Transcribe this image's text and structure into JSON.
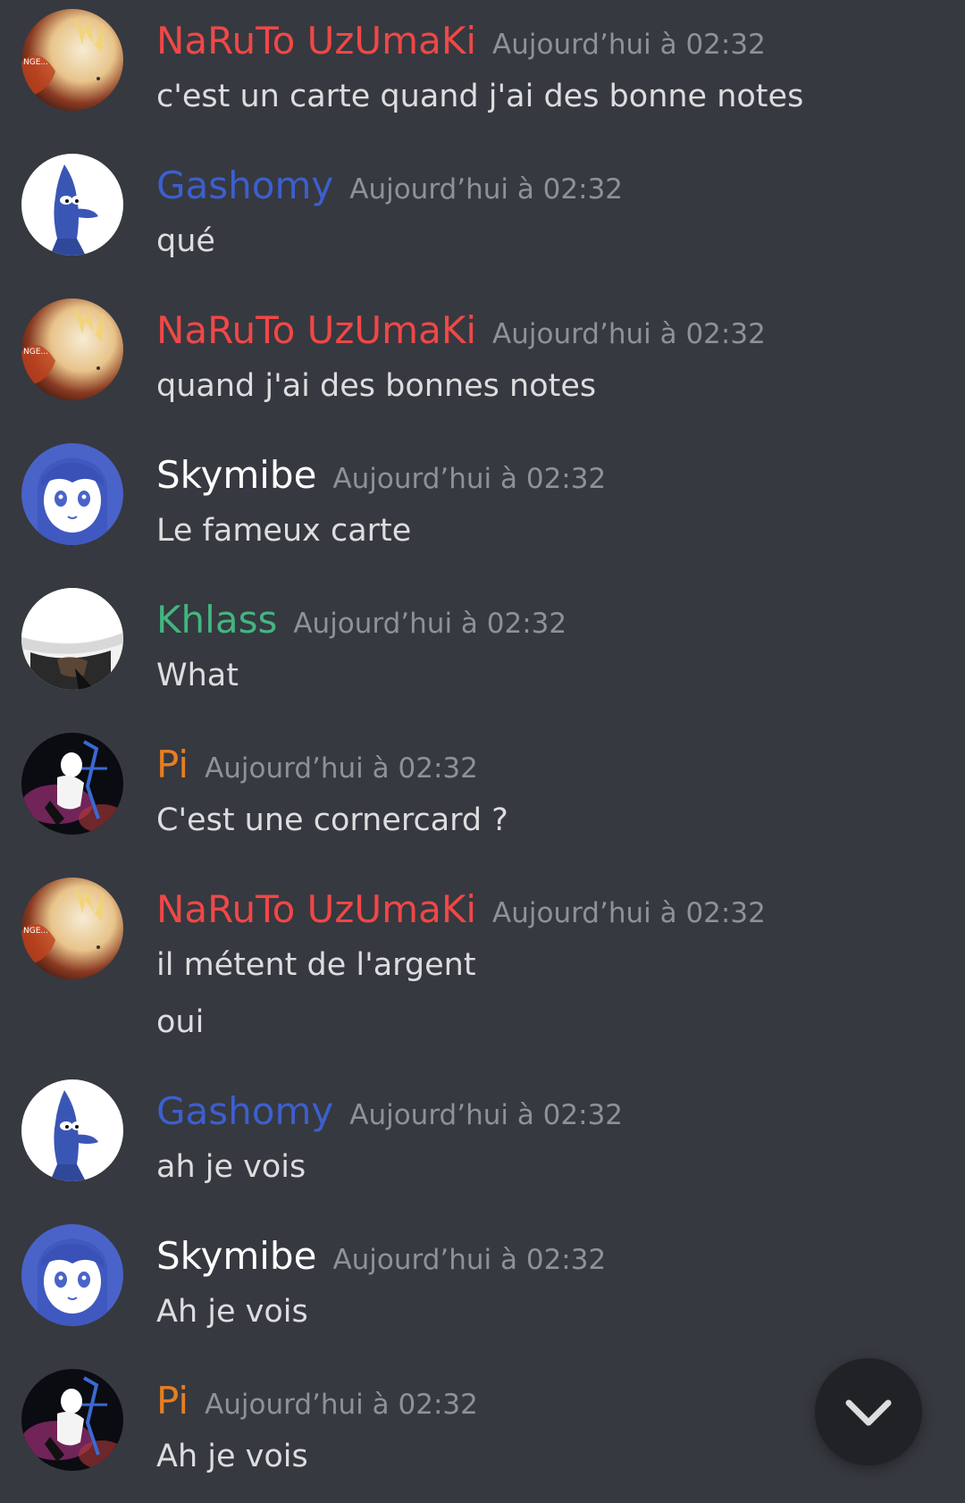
{
  "colors": {
    "background": "#36393f",
    "timestamp": "#8e9297",
    "message_text": "#dcddde",
    "naruto": "#f04747",
    "gashomy": "#3c5fcf",
    "skymibe": "#ffffff",
    "khlass": "#43b581",
    "pi": "#e67e22",
    "scroll_button": "#202225"
  },
  "messages": [
    {
      "avatar_icon": "naruto-avatar-icon",
      "username": "NaRuTo UzUmaKi",
      "timestamp": "Aujourd’hui à 02:32",
      "lines": [
        "c'est un carte quand j'ai des bonne notes"
      ]
    },
    {
      "avatar_icon": "duck-avatar-icon",
      "username": "Gashomy",
      "timestamp": "Aujourd’hui à 02:32",
      "lines": [
        "qué"
      ]
    },
    {
      "avatar_icon": "naruto-avatar-icon",
      "username": "NaRuTo UzUmaKi",
      "timestamp": "Aujourd’hui à 02:32",
      "lines": [
        "quand j'ai des bonnes notes"
      ]
    },
    {
      "avatar_icon": "anime-girl-avatar-icon",
      "username": "Skymibe",
      "timestamp": "Aujourd’hui à 02:32",
      "lines": [
        "Le fameux carte"
      ]
    },
    {
      "avatar_icon": "hat-avatar-icon",
      "username": "Khlass",
      "timestamp": "Aujourd’hui à 02:32",
      "lines": [
        "What"
      ]
    },
    {
      "avatar_icon": "chair-figure-avatar-icon",
      "username": "Pi",
      "timestamp": "Aujourd’hui à 02:32",
      "lines": [
        "C'est une cornercard ?"
      ]
    },
    {
      "avatar_icon": "naruto-avatar-icon",
      "username": "NaRuTo UzUmaKi",
      "timestamp": "Aujourd’hui à 02:32",
      "lines": [
        "il métent de l'argent",
        "oui"
      ]
    },
    {
      "avatar_icon": "duck-avatar-icon",
      "username": "Gashomy",
      "timestamp": "Aujourd’hui à 02:32",
      "lines": [
        "ah je vois"
      ]
    },
    {
      "avatar_icon": "anime-girl-avatar-icon",
      "username": "Skymibe",
      "timestamp": "Aujourd’hui à 02:32",
      "lines": [
        "Ah je vois"
      ]
    },
    {
      "avatar_icon": "chair-figure-avatar-icon",
      "username": "Pi",
      "timestamp": "Aujourd’hui à 02:32",
      "lines": [
        "Ah je vois"
      ]
    }
  ],
  "naruto_avatar_text": "NGE...",
  "scroll_button_icon": "chevron-down-icon"
}
